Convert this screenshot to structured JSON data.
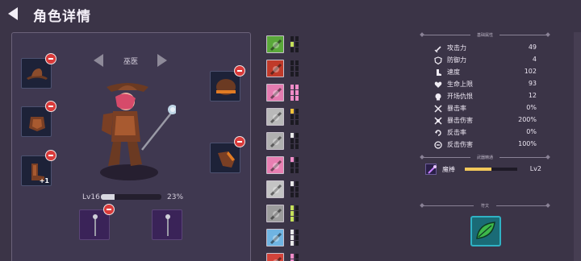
{
  "header": {
    "title": "角色详情"
  },
  "character": {
    "name": "巫医",
    "level_label": "Lv16",
    "level_progress": 0.23,
    "level_percent": "23%"
  },
  "equipment": {
    "left_slots": [
      {
        "item": "hat-icon",
        "bonus": ""
      },
      {
        "item": "chest-armor-icon",
        "bonus": ""
      },
      {
        "item": "boot-icon",
        "bonus": "+1"
      }
    ],
    "right_slots": [
      {
        "item": "helmet-icon"
      },
      {
        "item": "gauntlet-icon"
      }
    ],
    "weapon_slots": [
      {
        "item": "staff-icon"
      },
      {
        "item": "staff-icon"
      }
    ]
  },
  "skills": [
    {
      "icon": "potion-skill-icon",
      "bg": "#5aa83a",
      "pips": [
        "#1c1a22",
        "#1c1a22",
        "#c5e05a",
        "#1c1a22",
        "#1c1a22",
        "#1c1a22"
      ]
    },
    {
      "icon": "bull-skill-icon",
      "bg": "#c03a2a",
      "pips": [
        "#1c1a22",
        "#1c1a22",
        "#1c1a22",
        "#1c1a22",
        "#1c1a22",
        "#1c1a22"
      ]
    },
    {
      "icon": "poison-skill-icon",
      "bg": "#e47bb0",
      "pips": [
        "#f08cc8",
        "#f08cc8",
        "#f08cc8",
        "#f08cc8",
        "#f08cc8",
        "#f08cc8"
      ]
    },
    {
      "icon": "claw-skill-icon",
      "bg": "#b9b9b9",
      "pips": [
        "#f2c33a",
        "#1c1a22",
        "#1c1a22",
        "#1c1a22",
        "#1c1a22",
        "#1c1a22"
      ]
    },
    {
      "icon": "crystal-skill-icon",
      "bg": "#b0b0b0",
      "pips": [
        "#e8e8e8",
        "#1c1a22",
        "#1c1a22",
        "#1c1a22",
        "#1c1a22",
        "#1c1a22"
      ]
    },
    {
      "icon": "slash-skill-icon",
      "bg": "#e87fb2",
      "pips": [
        "#f08cc8",
        "#1c1a22",
        "#1c1a22",
        "#1c1a22",
        "#1c1a22",
        "#1c1a22"
      ]
    },
    {
      "icon": "blade-skill-icon",
      "bg": "#c4c4c4",
      "pips": [
        "#e8e8e8",
        "#1c1a22",
        "#1c1a22",
        "#1c1a22",
        "#1c1a22",
        "#1c1a22"
      ]
    },
    {
      "icon": "shield-skill-icon",
      "bg": "#9c9c9c",
      "pips": [
        "#c5e05a",
        "#1c1a22",
        "#c5e05a",
        "#1c1a22",
        "#c5e05a",
        "#1c1a22"
      ]
    },
    {
      "icon": "wing-skill-icon",
      "bg": "#6fb4e2",
      "pips": [
        "#e8e8e8",
        "#1c1a22",
        "#e8e8e8",
        "#1c1a22",
        "#e8e8e8",
        "#1c1a22"
      ]
    },
    {
      "icon": "swords-skill-icon",
      "bg": "#d3433a",
      "pips": [
        "#f08cc8",
        "#1c1a22",
        "#f08cc8",
        "#1c1a22",
        "#f08cc8",
        "#1c1a22"
      ]
    }
  ],
  "stats": {
    "section_title": "基础属性",
    "rows": [
      {
        "icon": "sword-icon",
        "name": "攻击力",
        "value": "49"
      },
      {
        "icon": "shield-icon",
        "name": "防御力",
        "value": "4"
      },
      {
        "icon": "boot-speed-icon",
        "name": "速度",
        "value": "102"
      },
      {
        "icon": "heart-icon",
        "name": "生命上限",
        "value": "93"
      },
      {
        "icon": "skull-icon",
        "name": "开场仇恨",
        "value": "12"
      },
      {
        "icon": "crit-icon",
        "name": "暴击率",
        "value": "0%"
      },
      {
        "icon": "crit-damage-icon",
        "name": "暴击伤害",
        "value": "200%"
      },
      {
        "icon": "counter-icon",
        "name": "反击率",
        "value": "0%"
      },
      {
        "icon": "counter-damage-icon",
        "name": "反击伤害",
        "value": "100%"
      }
    ]
  },
  "weapon_mastery": {
    "section_title": "武器精通",
    "name": "魔棒",
    "progress": 0.5,
    "level": "Lv2"
  },
  "rune": {
    "section_title": "符文",
    "icon": "leaf-rune-icon"
  }
}
